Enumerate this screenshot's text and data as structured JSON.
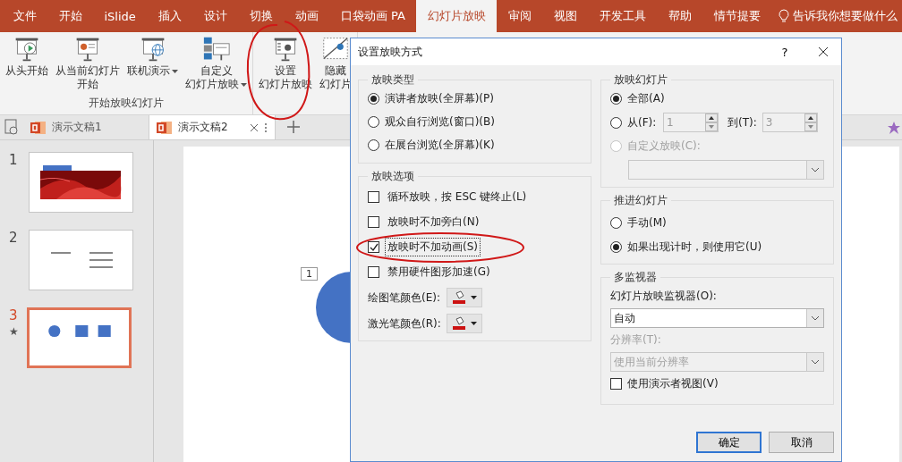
{
  "menu_tabs": [
    {
      "label": "文件",
      "selected": false
    },
    {
      "label": "开始",
      "selected": false
    },
    {
      "label": "iSlide",
      "selected": false
    },
    {
      "label": "插入",
      "selected": false
    },
    {
      "label": "设计",
      "selected": false
    },
    {
      "label": "切换",
      "selected": false
    },
    {
      "label": "动画",
      "selected": false
    },
    {
      "label": "口袋动画 PA",
      "selected": false
    },
    {
      "label": "幻灯片放映",
      "selected": true
    },
    {
      "label": "审阅",
      "selected": false
    },
    {
      "label": "视图",
      "selected": false
    },
    {
      "label": "开发工具",
      "selected": false
    },
    {
      "label": "帮助",
      "selected": false
    },
    {
      "label": "情节提要",
      "selected": false
    }
  ],
  "tell_me": "告诉我你想要做什么",
  "ribbon": {
    "groups": [
      {
        "label": "开始放映幻灯片",
        "buttons": [
          {
            "lines": [
              "从头开始"
            ],
            "dropdown": false
          },
          {
            "lines": [
              "从当前幻灯片",
              "开始"
            ],
            "dropdown": false
          },
          {
            "lines": [
              "联机演示"
            ],
            "dropdown": true
          },
          {
            "lines": [
              "自定义",
              "幻灯片放映"
            ],
            "dropdown": true
          }
        ]
      },
      {
        "buttons": [
          {
            "lines": [
              "设置",
              "幻灯片放映"
            ],
            "dropdown": false
          },
          {
            "lines": [
              "隐藏",
              "幻灯片"
            ],
            "dropdown": false
          }
        ]
      }
    ]
  },
  "doc_tabs": [
    {
      "title": "演示文稿1",
      "selected": false
    },
    {
      "title": "演示文稿2",
      "selected": true
    }
  ],
  "slides": [
    {
      "number": "1",
      "selected": false,
      "kind": "picture"
    },
    {
      "number": "2",
      "selected": false,
      "kind": "text"
    },
    {
      "number": "3",
      "selected": true,
      "kind": "shapes",
      "animation_mark": "★"
    }
  ],
  "canvas": {
    "placeholder_number": "1"
  },
  "dialog": {
    "title": "设置放映方式",
    "help": "?",
    "show_type": {
      "title": "放映类型",
      "options": [
        {
          "label": "演讲者放映(全屏幕)(P)",
          "selected": true
        },
        {
          "label": "观众自行浏览(窗口)(B)",
          "selected": false
        },
        {
          "label": "在展台浏览(全屏幕)(K)",
          "selected": false
        }
      ]
    },
    "show_options": {
      "title": "放映选项",
      "checkboxes": [
        {
          "label": "循环放映，按 ESC 键终止(L)",
          "checked": false,
          "focused": false
        },
        {
          "label": "放映时不加旁白(N)",
          "checked": false,
          "focused": false
        },
        {
          "label": "放映时不加动画(S)",
          "checked": true,
          "focused": true
        },
        {
          "label": "禁用硬件图形加速(G)",
          "checked": false,
          "focused": false
        }
      ],
      "pens": [
        {
          "label": "绘图笔颜色(E):",
          "color": "#cc1111"
        },
        {
          "label": "激光笔颜色(R):",
          "color": "#cc1111"
        }
      ]
    },
    "show_slides": {
      "title": "放映幻灯片",
      "options": [
        {
          "label": "全部(A)",
          "selected": true,
          "disabled": false
        },
        {
          "label": "从(F):",
          "selected": false,
          "disabled": false
        },
        {
          "label": "自定义放映(C):",
          "selected": false,
          "disabled": true
        }
      ],
      "from": "1",
      "to_label": "到(T):",
      "to": "3"
    },
    "advance": {
      "title": "推进幻灯片",
      "options": [
        {
          "label": "手动(M)",
          "selected": false
        },
        {
          "label": "如果出现计时，则使用它(U)",
          "selected": true
        }
      ]
    },
    "monitors": {
      "title": "多监视器",
      "monitor_label": "幻灯片放映监视器(O):",
      "monitor_value": "自动",
      "resolution_label": "分辨率(T):",
      "resolution_value": "使用当前分辨率",
      "resolution_disabled": true,
      "presenter_view": {
        "label": "使用演示者视图(V)",
        "checked": false
      }
    },
    "buttons": [
      {
        "label": "确定",
        "default": true
      },
      {
        "label": "取消",
        "default": false
      }
    ]
  }
}
